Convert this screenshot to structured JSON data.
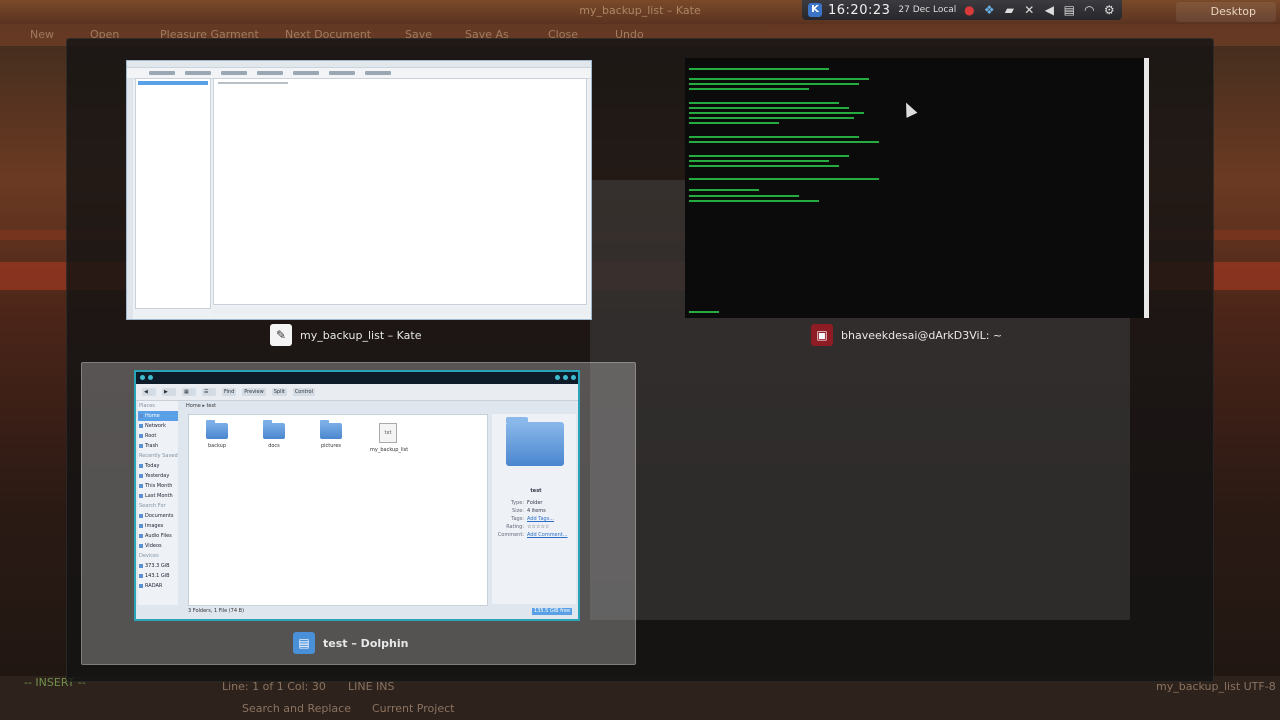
{
  "background_window": {
    "title": "my_backup_list – Kate",
    "toolbar": [
      "New",
      "Open",
      "Pleasure Garment",
      "Next Document",
      "Save",
      "Save As",
      "Close",
      "Undo"
    ],
    "status": {
      "line_col": "Line: 1 of 1  Col: 30",
      "mode": "LINE  INS",
      "filename": "my_backup_list  UTF-8",
      "insert": "-- INSERT --",
      "search": "Search and Replace",
      "project": "Current Project"
    }
  },
  "panel": {
    "clock": "16:20:23",
    "date": "27 Dec Local",
    "desktop_label": "Desktop"
  },
  "switcher": {
    "windows": [
      {
        "title": "my_backup_list – Kate",
        "icon": "kate-icon",
        "selected": false
      },
      {
        "title": "bhaveekdesai@dArkD3ViL: ~",
        "icon": "konsole-icon",
        "selected": false
      },
      {
        "title": "test – Dolphin",
        "icon": "dolphin-icon",
        "selected": true
      }
    ]
  },
  "dolphin": {
    "breadcrumb": "Home  ▸  test",
    "toolbar": [
      "Find",
      "Preview",
      "Split",
      "Control"
    ],
    "places": [
      {
        "label": "Places",
        "header": true
      },
      {
        "label": "Home",
        "selected": true
      },
      {
        "label": "Network"
      },
      {
        "label": "Root"
      },
      {
        "label": "Trash"
      },
      {
        "label": "Recently Saved",
        "header": true
      },
      {
        "label": "Today"
      },
      {
        "label": "Yesterday"
      },
      {
        "label": "This Month"
      },
      {
        "label": "Last Month"
      },
      {
        "label": "Search For",
        "header": true
      },
      {
        "label": "Documents"
      },
      {
        "label": "Images"
      },
      {
        "label": "Audio Files"
      },
      {
        "label": "Videos"
      },
      {
        "label": "Devices",
        "header": true
      },
      {
        "label": "373.3 GiB"
      },
      {
        "label": "143.1 GiB"
      },
      {
        "label": "RADAR"
      }
    ],
    "items": [
      {
        "name": "backup",
        "type": "folder"
      },
      {
        "name": "docs",
        "type": "folder"
      },
      {
        "name": "pictures",
        "type": "folder"
      },
      {
        "name": "my_backup_list",
        "type": "file",
        "ext": "txt"
      }
    ],
    "info": {
      "name": "test",
      "type": "Folder",
      "size": "4 items",
      "tags": "Add Tags...",
      "rating": "☆☆☆☆☆",
      "comment": "Add Comment..."
    },
    "status": "3 Folders, 1 File (74 B)",
    "free": "135.5 GiB free"
  },
  "colors": {
    "accent": "#2aa4b8",
    "selection": "#5aa0e6",
    "terminal_text": "#2bc84a"
  }
}
